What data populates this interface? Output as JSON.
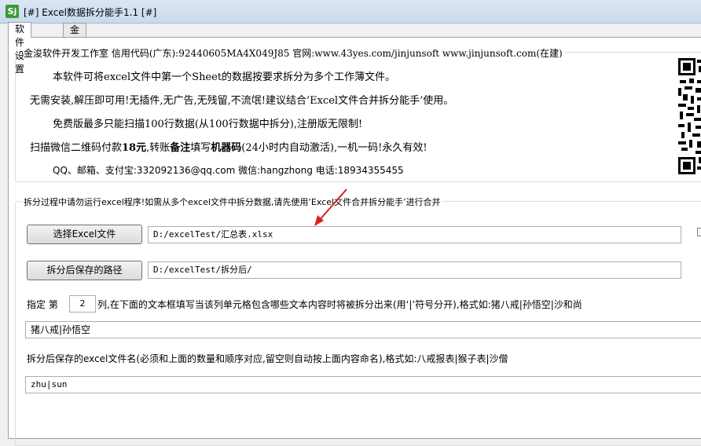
{
  "window": {
    "app_icon_text": "Sj",
    "title": "[#] Excel数据拆分能手1.1 [#]"
  },
  "tabs": [
    {
      "label": "软件设置"
    },
    {
      "label": "金浚软件"
    }
  ],
  "info": {
    "legend": "金浚软件开发工作室 信用代码(广东):92440605MA4X049J85 官网:www.43yes.com/jinjunsoft  www.jinjunsoft.com(在建)",
    "line1": "本软件可将excel文件中第一个Sheet的数据按要求拆分为多个工作薄文件。",
    "line2": "无需安装,解压即可用!无插件,无广告,无残留,不流氓!建议结合’Excel文件合并拆分能手’使用。",
    "line3": "免费版最多只能扫描100行数据(从100行数据中拆分),注册版无限制!",
    "line4a": "扫描微信二维码付款",
    "line4_amount": "18元",
    "line4b": ",转账",
    "line4_note": "备注",
    "line4c": "填写",
    "line4_code": "机器码",
    "line4d": "(24小时内自动激活),一机一码!永久有效!",
    "line5": "QQ、邮箱、支付宝:332092136@qq.com    微信:hangzhong    电话:18934355455"
  },
  "split": {
    "legend": "拆分过程中请勿运行excel程序!如需从多个excel文件中拆分数据,请先使用’Excel文件合并拆分能手’进行合并",
    "select_button": "选择Excel文件",
    "file_path": "D:/excelTest/汇总表.xlsx",
    "save_button": "拆分后保存的路径",
    "save_path": "D:/excelTest/拆分后/",
    "col_prefix": "指定 第",
    "col_value": "2",
    "col_suffix": "列,在下面的文本框填写当该列单元格包含哪些文本内容时将被拆分出来(用‘|’符号分开),格式如:猪八戒|孙悟空|沙和尚",
    "filter_value": "猪八戒|孙悟空",
    "names_label": "拆分后保存的excel文件名(必须和上面的数量和顺序对应,留空则自动按上面内容命名),格式如:八戒报表|猴子表|沙僧",
    "names_value": "zhu|sun"
  },
  "colors": {
    "titlebar": "#dbe6f3",
    "arrow": "#d62020"
  }
}
